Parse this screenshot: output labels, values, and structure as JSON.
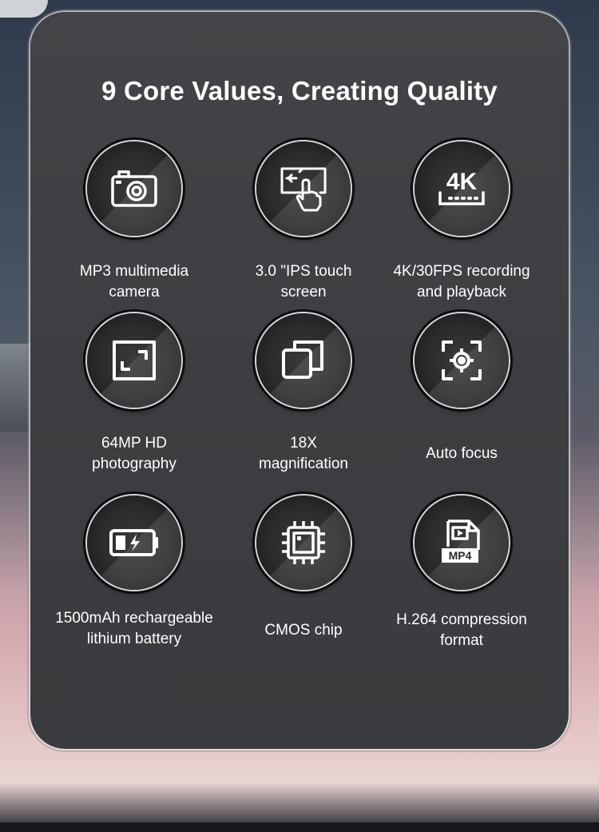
{
  "title": "9 Core Values, Creating Quality",
  "features": [
    {
      "line1": "MP3 multimedia",
      "line2": "camera",
      "icon": "camera-icon"
    },
    {
      "line1": "3.0 \"IPS touch",
      "line2": "screen",
      "icon": "touch-screen-icon"
    },
    {
      "line1": "4K/30FPS recording",
      "line2": "and playback",
      "icon": "4k-icon",
      "icon_text": "4K"
    },
    {
      "line1": "64MP HD",
      "line2": "photography",
      "icon": "frame-icon"
    },
    {
      "line1": "18X",
      "line2": "magnification",
      "icon": "zoom-icon"
    },
    {
      "line1": "Auto focus",
      "line2": "",
      "icon": "autofocus-icon"
    },
    {
      "line1": "1500mAh rechargeable",
      "line2": "lithium battery",
      "icon": "battery-icon"
    },
    {
      "line1": "CMOS chip",
      "line2": "",
      "icon": "chip-icon"
    },
    {
      "line1": "H.264 compression",
      "line2": "format",
      "icon": "mp4-file-icon",
      "icon_text": "MP4"
    }
  ]
}
